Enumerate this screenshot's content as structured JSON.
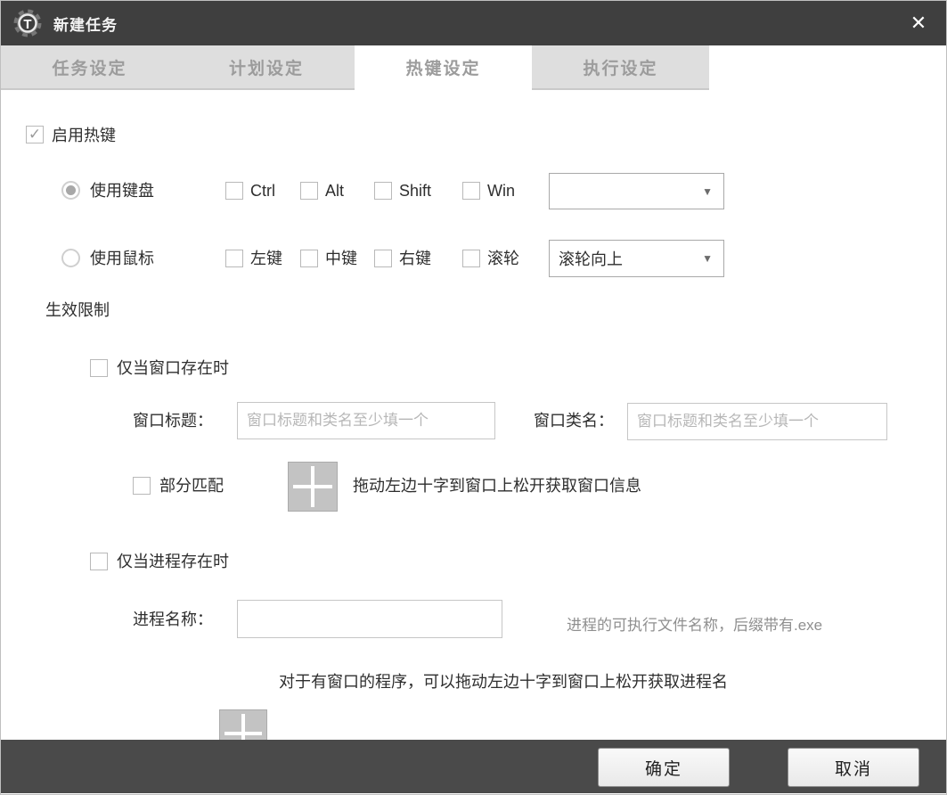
{
  "window": {
    "title": "新建任务",
    "logo_letter": "T"
  },
  "icons": {
    "close": "✕",
    "dropdown_arrow": "▼",
    "check": "✓"
  },
  "tabs": [
    {
      "label": "任务设定",
      "active": false
    },
    {
      "label": "计划设定",
      "active": false
    },
    {
      "label": "热键设定",
      "active": true
    },
    {
      "label": "执行设定",
      "active": false
    }
  ],
  "hotkey": {
    "enable_label": "启用热键",
    "enable_checked": true,
    "keyboard": {
      "radio_label": "使用键盘",
      "selected": true,
      "modifiers": [
        "Ctrl",
        "Alt",
        "Shift",
        "Win"
      ],
      "key_select_value": ""
    },
    "mouse": {
      "radio_label": "使用鼠标",
      "selected": false,
      "buttons": [
        "左键",
        "中键",
        "右键",
        "滚轮"
      ],
      "wheel_select_value": "滚轮向上"
    }
  },
  "limits": {
    "section_label": "生效限制",
    "window_exists": {
      "checkbox_label": "仅当窗口存在时",
      "title_label": "窗口标题：",
      "title_value": "",
      "title_placeholder": "窗口标题和类名至少填一个",
      "class_label": "窗口类名：",
      "class_value": "",
      "class_placeholder": "窗口标题和类名至少填一个",
      "partial_match_label": "部分匹配",
      "drag_hint": "拖动左边十字到窗口上松开获取窗口信息"
    },
    "process_exists": {
      "checkbox_label": "仅当进程存在时",
      "name_label": "进程名称：",
      "name_value": "",
      "name_hint": "进程的可执行文件名称，后缀带有.exe",
      "drag_hint": "对于有窗口的程序，可以拖动左边十字到窗口上松开获取进程名"
    }
  },
  "footer": {
    "ok_label": "确定",
    "cancel_label": "取消"
  },
  "colors": {
    "titlebar": "#3f3f3f",
    "footer_bar": "#4a4a4a",
    "tab_background": "#dedede",
    "tab_text": "#9c9c9c",
    "body_text": "#2e2e2e",
    "placeholder_text": "#b7b7b7",
    "hint_text": "#8f8f8f",
    "crosshair_background": "#c3c3c3"
  }
}
